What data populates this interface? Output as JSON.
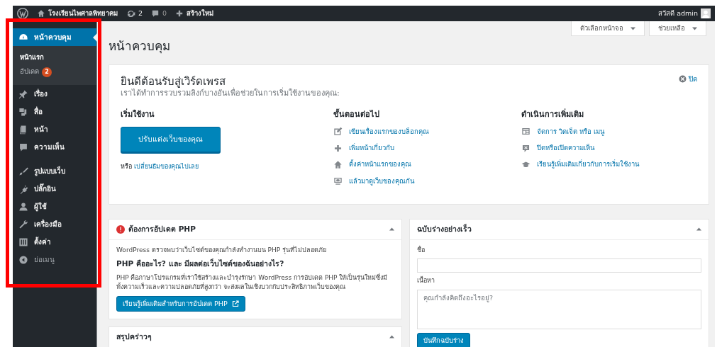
{
  "admin_bar": {
    "site_name": "โรงเรียนไพศาลพิทยาคม",
    "updates": "2",
    "comments": "0",
    "new": "สร้างใหม่",
    "greeting": "สวัสดี admin"
  },
  "sidebar": {
    "items": [
      {
        "label": "หน้าควบคุม",
        "selected": true,
        "children": [
          {
            "label": "หน้าแรก",
            "selected": true
          },
          {
            "label": "อัปเดต",
            "selected": false,
            "badge": "2"
          }
        ]
      },
      {
        "label": "เรื่อง",
        "selected": false
      },
      {
        "label": "สื่อ",
        "selected": false
      },
      {
        "label": "หน้า",
        "selected": false
      },
      {
        "label": "ความเห็น",
        "selected": false
      },
      {
        "label": "รูปแบบเว็บ",
        "selected": false
      },
      {
        "label": "ปลั๊กอิน",
        "selected": false
      },
      {
        "label": "ผู้ใช้",
        "selected": false
      },
      {
        "label": "เครื่องมือ",
        "selected": false
      },
      {
        "label": "ตั้งค่า",
        "selected": false
      },
      {
        "label": "ย่อเมนู",
        "selected": false
      }
    ]
  },
  "screen_buttons": [
    "ตัวเลือกหน้าจอ",
    "ช่วยเหลือ"
  ],
  "page_title": "หน้าควบคุม",
  "welcome": {
    "title": "ยินดีต้อนรับสู่เวิร์ดเพรส",
    "subtitle": "เราได้ทำการรวบรวมลิงก์บางอันเพื่อช่วยในการเริ่มใช้งานของคุณ:",
    "dismiss": "ปิด",
    "columns": [
      {
        "heading": "เริ่มใช้งาน",
        "button": "ปรับแต่งเว็บของคุณ",
        "or_text": "หรือ",
        "or_link": "เปลี่ยนธีมของคุณไปเลย"
      },
      {
        "heading": "ขั้นตอนต่อไป",
        "links": [
          "เขียนเรื่องแรกของบล็อกคุณ",
          "เพิ่มหน้าเกี่ยวกับ",
          "ตั้งค่าหน้าแรกของคุณ",
          "แล้วมาดูเว็บของคุณกัน"
        ]
      },
      {
        "heading": "ดำเนินการเพิ่มเติม",
        "links": [
          "จัดการ วิดเจ็ต หรือ เมนู",
          "ปิดหรือเปิดความเห็น",
          "เรียนรู้เพิ่มเติมเกี่ยวกับการเริ่มใช้งาน"
        ]
      }
    ]
  },
  "php_box": {
    "title": "ต้องการอัปเดต PHP",
    "text": "WordPress ตรวจพบว่าเว็บไซต์ของคุณกำลังทำงานบน PHP รุ่นที่ไม่ปลอดภัย",
    "question": "PHP คืออะไร? และ มีผลต่อเว็บไซต์ของฉันอย่างไร?",
    "explanation": "PHP คือภาษาโปรแกรมที่เราใช้สร้างและบำรุงรักษา WordPress การอัปเดต PHP ให้เป็นรุ่นใหม่ซึ่งมีทั้งความเร็วและความปลอดภัยที่สูงกว่า จะส่งผลในเชิงบวกกับประสิทธิภาพเว็บของคุณ",
    "button": "เรียนรู้เพิ่มเติมสำหรับการอัปเดต PHP"
  },
  "glance_box": {
    "title": "สรุปคร่าวๆ"
  },
  "draft_box": {
    "title": "ฉบับร่างอย่างเร็ว",
    "title_label": "ชื่อ",
    "content_label": "เนื้อหา",
    "content_placeholder": "คุณกำลังคิดถึงอะไรอยู่?",
    "button": "บันทึกฉบับร่าง"
  }
}
